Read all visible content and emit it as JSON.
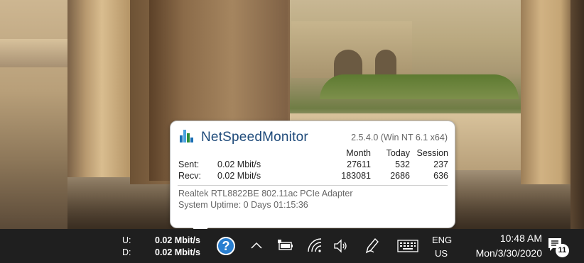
{
  "tooltip": {
    "title": "NetSpeedMonitor",
    "version": "2.5.4.0 (Win NT 6.1 x64)",
    "columns": [
      "Month",
      "Today",
      "Session"
    ],
    "rows": [
      {
        "label": "Sent:",
        "speed": "0.02 Mbit/s",
        "month": "27611",
        "today": "532",
        "session": "237"
      },
      {
        "label": "Recv:",
        "speed": "0.02 Mbit/s",
        "month": "183081",
        "today": "2686",
        "session": "636"
      }
    ],
    "adapter": "Realtek RTL8822BE 802.11ac PCIe Adapter",
    "uptime": "System Uptime: 0 Days 01:15:36",
    "logo_colors": [
      "#1a6fb3",
      "#4aa3df",
      "#2c8e3a"
    ]
  },
  "taskbar": {
    "upload_label": "U:",
    "download_label": "D:",
    "upload_value": "0.02 Mbit/s",
    "download_value": "0.02 Mbit/s",
    "help_glyph": "?",
    "tray_icons": [
      "chevron-up-icon",
      "battery-icon",
      "wifi-icon",
      "volume-icon",
      "pen-icon",
      "keyboard-icon"
    ],
    "language_top": "ENG",
    "language_bottom": "US",
    "time": "10:48 AM",
    "date": "Mon/3/30/2020",
    "notification_count": "11"
  }
}
